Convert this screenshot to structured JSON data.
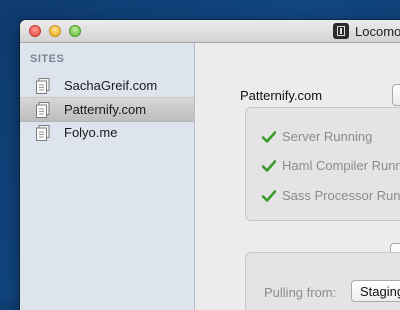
{
  "window": {
    "title": "Locomo"
  },
  "sidebar": {
    "header": "SITES",
    "sites": [
      {
        "label": "SachaGreif.com",
        "selected": false
      },
      {
        "label": "Patternify.com",
        "selected": true
      },
      {
        "label": "Folyo.me",
        "selected": false
      }
    ]
  },
  "main": {
    "site_name": "Patternify.com",
    "status": [
      {
        "label": "Server Running",
        "icon": "check-icon"
      },
      {
        "label": "Haml Compiler Running",
        "icon": "check-icon"
      },
      {
        "label": "Sass Processor Running",
        "icon": "check-icon"
      }
    ],
    "deploy": {
      "pulling_label": "Pulling from:",
      "source_value": "Staging"
    }
  },
  "colors": {
    "check": "#3a9a2a",
    "desktop": "#0f3f74",
    "sidebar": "#dde4ed"
  }
}
